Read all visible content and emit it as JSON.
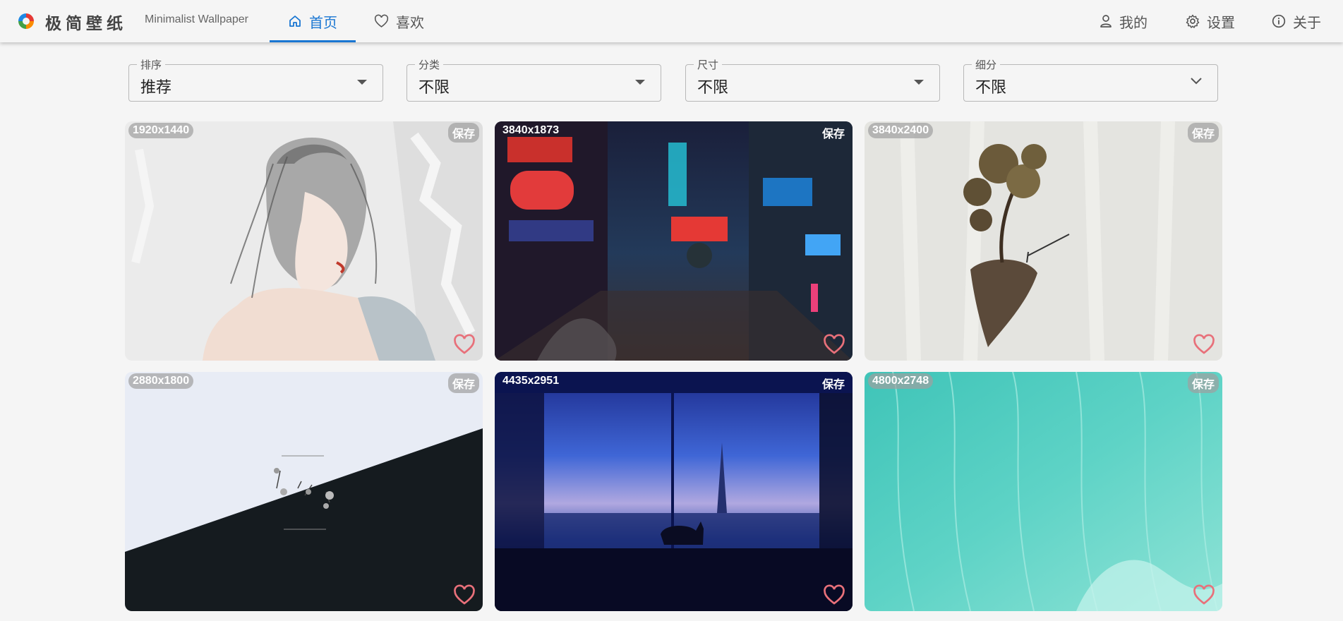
{
  "app": {
    "title": "极简壁纸",
    "subtitle": "Minimalist Wallpaper"
  },
  "nav": {
    "home": "首页",
    "favorites": "喜欢",
    "mine": "我的",
    "settings": "设置",
    "about": "关于"
  },
  "filters": [
    {
      "label": "排序",
      "value": "推荐"
    },
    {
      "label": "分类",
      "value": "不限"
    },
    {
      "label": "尺寸",
      "value": "不限"
    },
    {
      "label": "细分",
      "value": "不限"
    }
  ],
  "wallpapers": [
    {
      "resolution": "1920x1440",
      "save": "保存",
      "subject": "ink-sketch-girl"
    },
    {
      "resolution": "3840x1873",
      "save": "保存",
      "subject": "neon-city-street"
    },
    {
      "resolution": "3840x2400",
      "save": "保存",
      "subject": "floating-island-tree"
    },
    {
      "resolution": "2880x1800",
      "save": "保存",
      "subject": "life-death-diagonal"
    },
    {
      "resolution": "4435x2951",
      "save": "保存",
      "subject": "night-window-cat"
    },
    {
      "resolution": "4800x2748",
      "save": "保存",
      "subject": "turquoise-sea"
    }
  ],
  "colors": {
    "accent": "#1976d2",
    "heart": "#e8707a",
    "background": "#f5f5f5"
  }
}
